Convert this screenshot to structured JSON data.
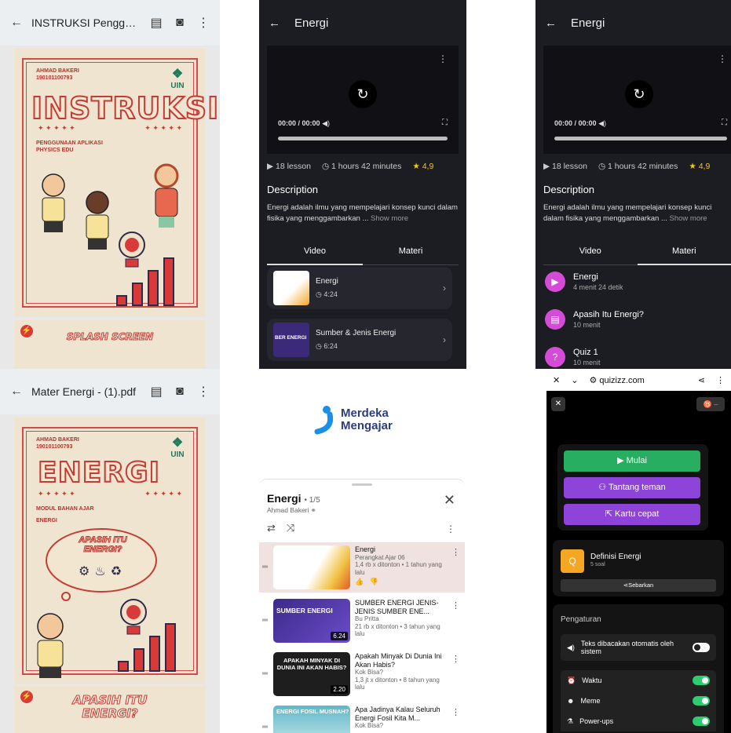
{
  "panel1": {
    "title": "INSTRUKSI Pengguna...",
    "author_name": "AHMAD BAKERI",
    "author_id": "190101100793",
    "big_title": "INSTRUKSI",
    "sub_line1": "PENGGUNAAN APLIKASI",
    "sub_line2": "PHYSICS EDU",
    "logo_text": "UIN",
    "footer_label": "SPLASH SCREEN"
  },
  "panel2": {
    "title": "Energi",
    "time": "00:00 / 00:00",
    "lessons": "18 lesson",
    "duration": "1 hours 42 minutes",
    "rating": "4,9",
    "desc_heading": "Description",
    "desc_text": "Energi adalah ilmu yang mempelajari konsep kunci dalam fisika yang menggambarkan ...",
    "show_more": "Show more",
    "tab_video": "Video",
    "tab_materi": "Materi",
    "videos": [
      {
        "title": "Energi",
        "duration": "4:24"
      },
      {
        "title": "Sumber & Jenis Energi",
        "duration": "6:24",
        "thumb_caption": "BER ENERGI"
      }
    ]
  },
  "panel3": {
    "title": "Energi",
    "time": "00:00 / 00:00",
    "lessons": "18 lesson",
    "duration": "1 hours 42 minutes",
    "rating": "4,9",
    "desc_heading": "Description",
    "desc_text": "Energi adalah ilmu yang mempelajari konsep kunci dalam fisika yang menggambarkan ...",
    "show_more": "Show more",
    "tab_video": "Video",
    "tab_materi": "Materi",
    "materi": [
      {
        "title": "Energi",
        "sub": "4 menit 24 detik"
      },
      {
        "title": "Apasih Itu Energi?",
        "sub": "10 menit"
      },
      {
        "title": "Quiz 1",
        "sub": "10 menit"
      }
    ]
  },
  "panel4": {
    "title": "Mater Energi - (1).pdf",
    "author_name": "AHMAD BAKERI",
    "author_id": "190101100793",
    "big_title": "ENERGI",
    "sub_line1": "MODUL BAHAN AJAR",
    "sub_line2": "ENERGI",
    "bubble": "APASIH ITU ENERGI?",
    "logo_text": "UIN",
    "footer_label": "APASIH ITU ENERGI?"
  },
  "panel5": {
    "brand1": "Merdeka",
    "brand2": "Mengajar",
    "playlist_title": "Energi",
    "playlist_count": "• 1/5",
    "playlist_author": "Ahmad Bakeri",
    "videos": [
      {
        "title": "Energi",
        "channel": "Perangkat Ajar 06",
        "stats": "1,4 rb x ditonton • 1 tahun yang lalu",
        "duration": "",
        "thumb_caption": ""
      },
      {
        "title": "SUMBER ENERGI JENIS-JENIS SUMBER ENE...",
        "channel": "Bu Pritta",
        "stats": "21 rb x ditonton • 3 tahun yang lalu",
        "duration": "6.24",
        "thumb_caption": "SUMBER ENERGI"
      },
      {
        "title": "Apakah Minyak Di Dunia Ini Akan Habis?",
        "channel": "Kok Bisa?",
        "stats": "1,3 jt x ditonton • 8 tahun yang lalu",
        "duration": "2.20",
        "thumb_caption": "APAKAH MINYAK DI DUNIA INI AKAN HABIS?"
      },
      {
        "title": "Apa Jadinya Kalau Seluruh Energi Fosil Kita M...",
        "channel": "Kok Bisa?",
        "stats": "",
        "duration": "",
        "thumb_caption": "ENERGI FOSIL MUSNAH?"
      }
    ]
  },
  "panel6": {
    "url": "quizizz.com",
    "btn_start": "Mulai",
    "btn_challenge": "Tantang teman",
    "btn_flash": "Kartu cepat",
    "quiz_title": "Definisi Energi",
    "quiz_count": "5 soal",
    "share": "Sebarkan",
    "settings_heading": "Pengaturan",
    "settings": [
      {
        "label": "Teks dibacakan otomatis oleh sistem",
        "on": false
      },
      {
        "label": "Waktu",
        "on": true
      },
      {
        "label": "Meme",
        "on": true
      },
      {
        "label": "Power-ups",
        "on": true
      }
    ]
  },
  "colors": {
    "dark_bg": "#1c1c23",
    "accent_purple": "#8e44d8",
    "quiz_green": "#2ecc71",
    "poster_red": "#c43c36"
  }
}
